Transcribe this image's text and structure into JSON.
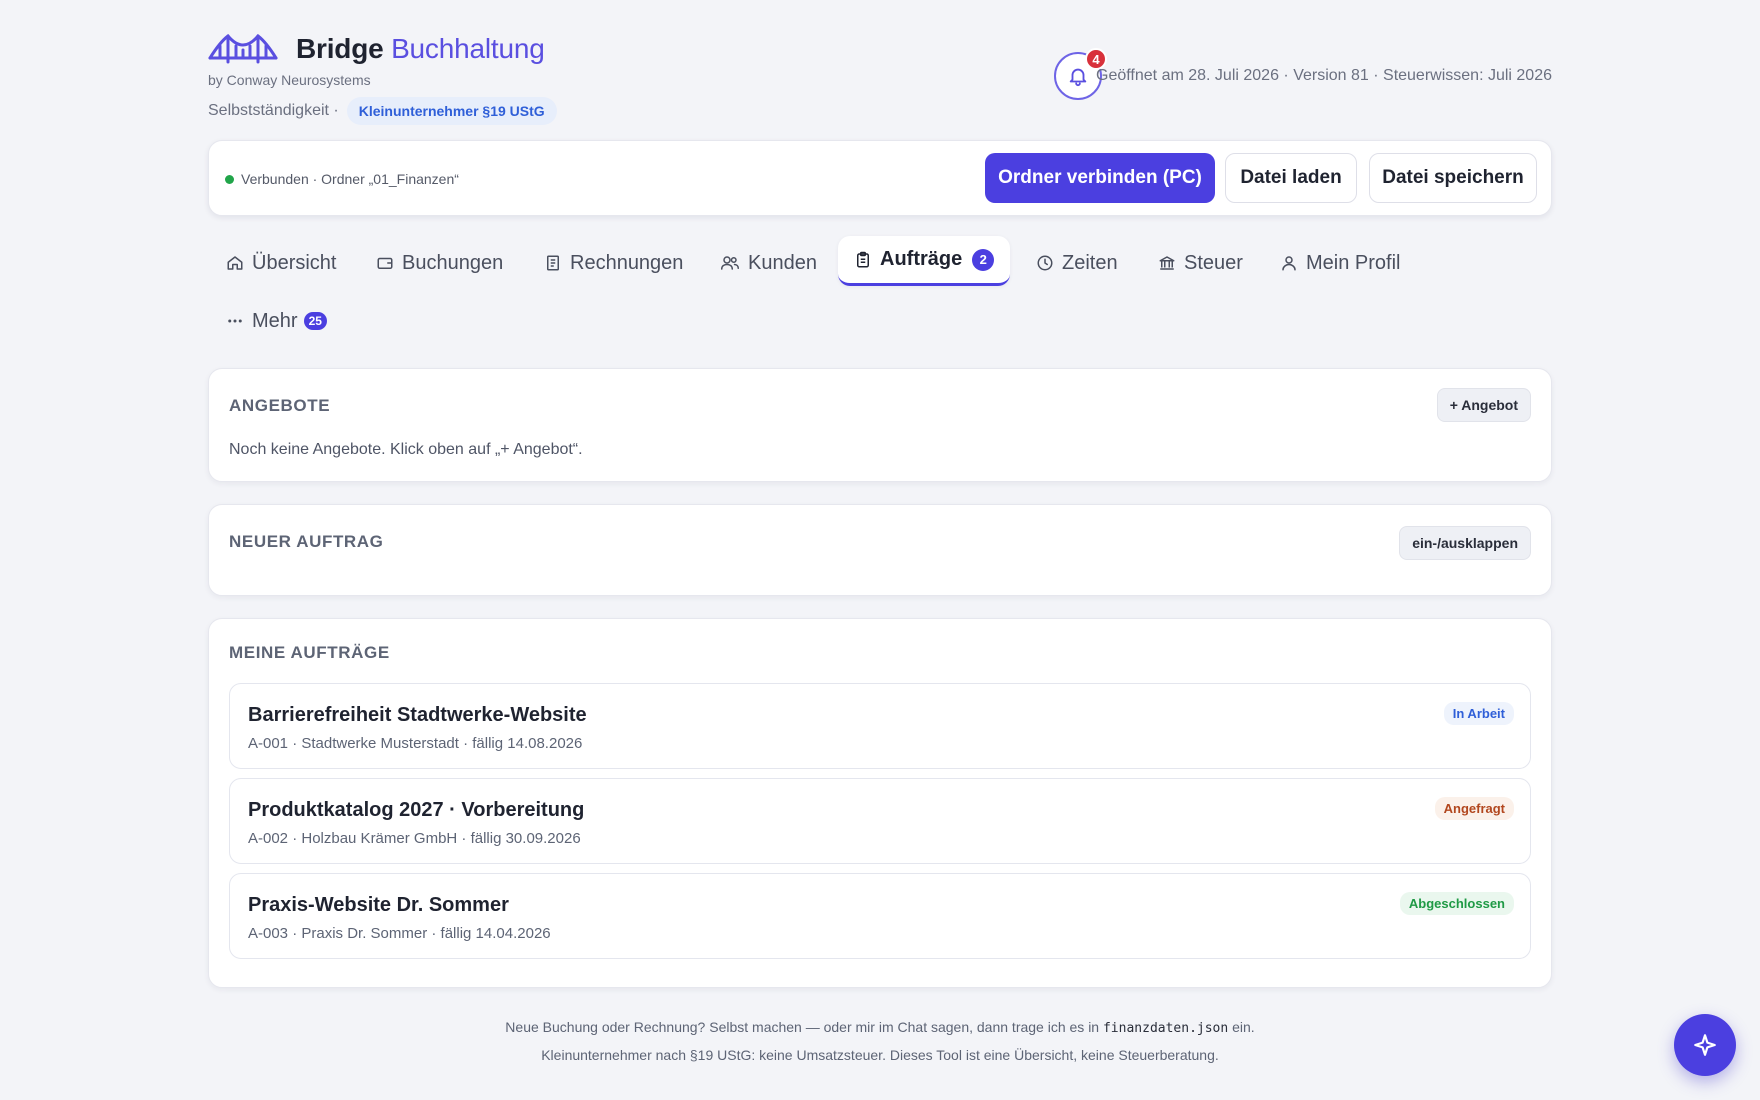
{
  "app": {
    "title_main": "Bridge",
    "title_accent": "Buchhaltung",
    "byline": "by Conway Neurosystems",
    "mode_label": "Selbstständigkeit ·",
    "mode_pill": "Kleinunternehmer §19 UStG",
    "notification_count": "4",
    "opened_info": "Geöffnet am 28. Juli 2026 · Version 81 · Steuerwissen: Juli 2026"
  },
  "connection": {
    "status_text": "Verbunden · Ordner „01_Finanzen“",
    "status_color": "#21a54a",
    "connect_label": "Ordner verbinden (PC)",
    "load_label": "Datei laden",
    "save_label": "Datei speichern"
  },
  "tabs": [
    {
      "label": "Übersicht",
      "icon": "home-icon"
    },
    {
      "label": "Buchungen",
      "icon": "wallet-icon"
    },
    {
      "label": "Rechnungen",
      "icon": "document-icon"
    },
    {
      "label": "Kunden",
      "icon": "users-icon"
    },
    {
      "label": "Aufträge",
      "icon": "clipboard-icon",
      "badge": "2",
      "active": true
    },
    {
      "label": "Zeiten",
      "icon": "clock-icon"
    },
    {
      "label": "Steuer",
      "icon": "bank-icon"
    },
    {
      "label": "Mein Profil",
      "icon": "user-icon"
    },
    {
      "label": "Mehr",
      "icon": "more-icon",
      "badge": "25"
    }
  ],
  "offers": {
    "title": "ANGEBOTE",
    "add_label": "+ Angebot",
    "empty_text": "Noch keine Angebote. Klick oben auf „+ Angebot“."
  },
  "new_order": {
    "title": "NEUER AUFTRAG",
    "toggle_label": "ein-/ausklappen"
  },
  "my_orders": {
    "title": "MEINE AUFTRÄGE",
    "items": [
      {
        "title": "Barrierefreiheit Stadtwerke-Website",
        "subtitle": "A-001 · Stadtwerke Musterstadt · fällig 14.08.2026",
        "status": "In Arbeit",
        "status_color": "#2f5fd8"
      },
      {
        "title": "Produktkatalog 2027 · Vorbereitung",
        "subtitle": "A-002 · Holzbau Krämer GmbH · fällig 30.09.2026",
        "status": "Angefragt",
        "status_color": "#b2471e"
      },
      {
        "title": "Praxis-Website Dr. Sommer",
        "subtitle": "A-003 · Praxis Dr. Sommer · fällig 14.04.2026",
        "status": "Abgeschlossen",
        "status_color": "#1f9a45"
      }
    ]
  },
  "footer": {
    "line1_before": "Neue Buchung oder Rechnung? Selbst machen — oder mir im Chat sagen, dann trage ich es in",
    "line1_code": "finanzdaten.json",
    "line1_after": "ein.",
    "line2": "Kleinunternehmer nach §19 UStG: keine Umsatzsteuer. Dieses Tool ist eine Übersicht, keine Steuerberatung."
  },
  "colors": {
    "accent": "#4b3fe0",
    "background": "#f3f4f8"
  },
  "assistant_button_icon": "sparkle-icon"
}
